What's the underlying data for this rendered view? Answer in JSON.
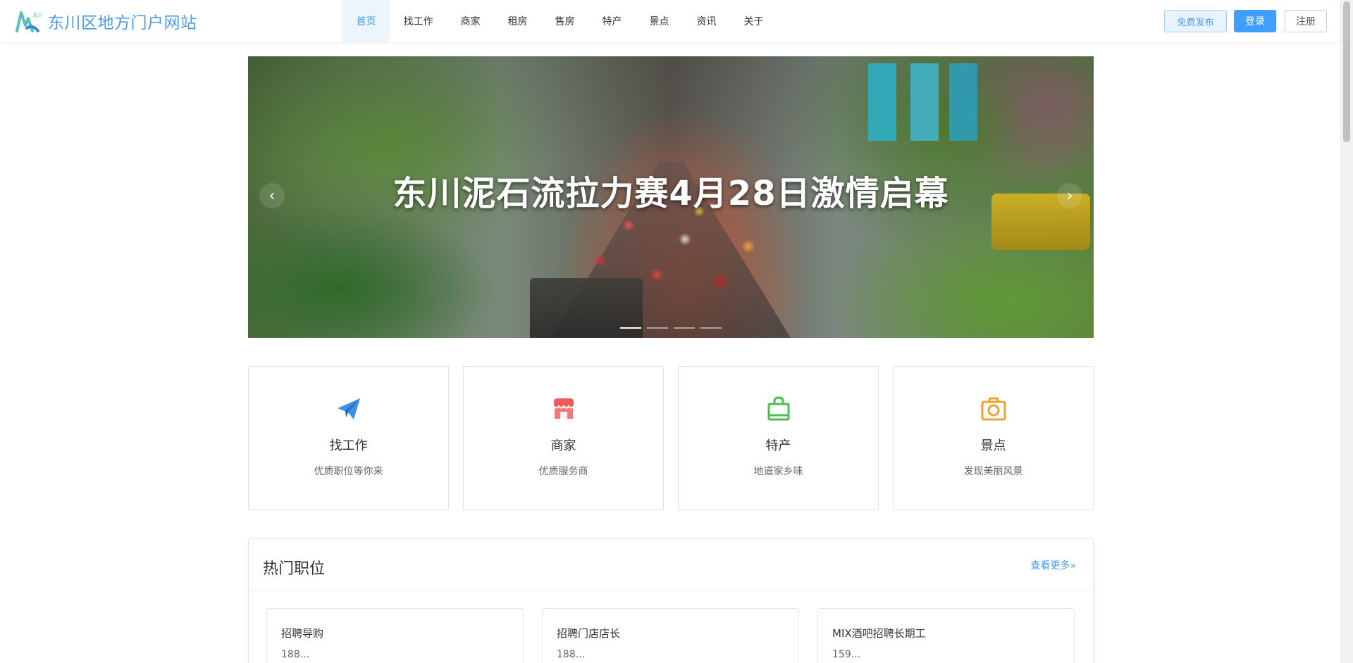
{
  "header": {
    "site_name": "东川区地方门户网站",
    "logo_mark_text": "东川",
    "nav": [
      {
        "label": "首页",
        "active": true
      },
      {
        "label": "找工作",
        "active": false
      },
      {
        "label": "商家",
        "active": false
      },
      {
        "label": "租房",
        "active": false
      },
      {
        "label": "售房",
        "active": false
      },
      {
        "label": "特产",
        "active": false
      },
      {
        "label": "景点",
        "active": false
      },
      {
        "label": "资讯",
        "active": false
      },
      {
        "label": "关于",
        "active": false
      }
    ],
    "publish_label": "免费发布",
    "login_label": "登录",
    "register_label": "注册"
  },
  "carousel": {
    "title": "东川泥石流拉力赛4月28日激情启幕",
    "prev_glyph": "‹",
    "next_glyph": "›",
    "slide_count": 4,
    "active_index": 0
  },
  "categories": [
    {
      "title": "找工作",
      "subtitle": "优质职位等你来",
      "icon": "paper-plane-icon",
      "color": "#3d8fe8"
    },
    {
      "title": "商家",
      "subtitle": "优质服务商",
      "icon": "store-icon",
      "color": "#f05a5a"
    },
    {
      "title": "特产",
      "subtitle": "地道家乡味",
      "icon": "shopping-bag-icon",
      "color": "#4cbf4c"
    },
    {
      "title": "景点",
      "subtitle": "发现美丽风景",
      "icon": "camera-icon",
      "color": "#eda235"
    }
  ],
  "hot_jobs": {
    "title": "热门职位",
    "more_label": "查看更多»",
    "items": [
      {
        "title": "招聘导购",
        "salary": "188..."
      },
      {
        "title": "招聘门店店长",
        "salary": "188..."
      },
      {
        "title": "MIX酒吧招聘长期工",
        "salary": "159..."
      }
    ]
  }
}
